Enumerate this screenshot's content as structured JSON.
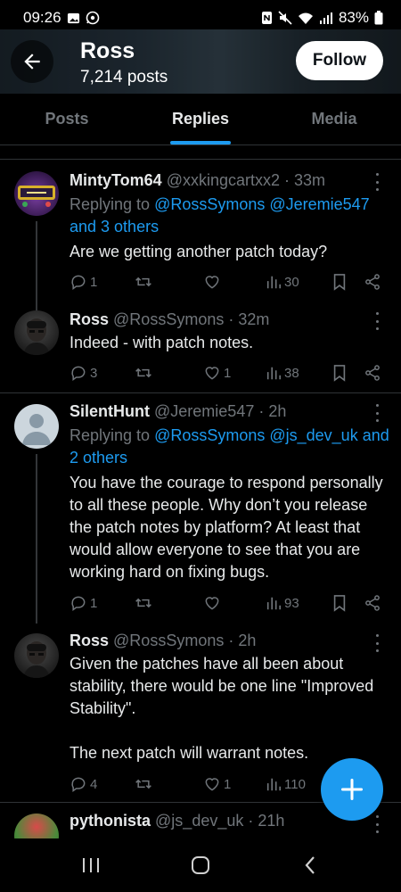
{
  "status_bar": {
    "time": "09:26",
    "battery": "83%",
    "left_icons": [
      "gallery-icon",
      "whatsapp-icon"
    ],
    "right_icons": [
      "nfc-icon",
      "mute-icon",
      "wifi-icon",
      "signal-icon",
      "battery-icon"
    ]
  },
  "header": {
    "name": "Ross",
    "posts": "7,214 posts",
    "follow_label": "Follow"
  },
  "tabs": [
    {
      "label": "Posts",
      "active": false
    },
    {
      "label": "Replies",
      "active": true
    },
    {
      "label": "Media",
      "active": false
    }
  ],
  "tweets": [
    {
      "name": "MintyTom64",
      "meta": "@xxkingcartxx2 · 33m",
      "reply_prefix": "Replying to ",
      "reply_mentions": "@RossSymons @Jeremie547",
      "reply_more": "and 3 others",
      "body": "Are we getting another patch today?",
      "replies": "1",
      "reposts": "",
      "likes": "",
      "views": "30"
    },
    {
      "name": "Ross",
      "meta": "@RossSymons · 32m",
      "body": "Indeed - with patch notes.",
      "replies": "3",
      "reposts": "",
      "likes": "1",
      "views": "38"
    },
    {
      "name": "SilentHunt",
      "meta": "@Jeremie547 · 2h",
      "reply_prefix": "Replying to ",
      "reply_mentions": "@RossSymons @js_dev_uk",
      "reply_more": "and 2 others",
      "body": "You have the courage to respond personally to all these people. Why don’t you release the patch notes by platform? At least that would allow everyone to see that you are working hard on fixing bugs.",
      "replies": "1",
      "reposts": "",
      "likes": "",
      "views": "93"
    },
    {
      "name": "Ross",
      "meta": "@RossSymons · 2h",
      "body": "Given the patches have all been about stability, there would be one line \"Improved Stability\".\n\nThe next patch will warrant notes.",
      "replies": "4",
      "reposts": "",
      "likes": "1",
      "views": "110"
    },
    {
      "name": "pythonista",
      "meta": "@js_dev_uk · 21h"
    }
  ],
  "colors": {
    "accent": "#1d9bf0",
    "background": "#000000",
    "text": "#e7e9ea",
    "muted": "#71767b",
    "divider": "#2f3336"
  }
}
